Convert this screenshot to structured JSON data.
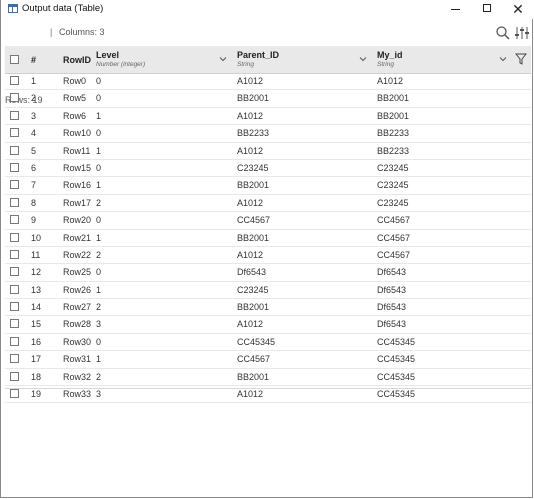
{
  "window": {
    "title": "Output data (Table)",
    "min_glyph": "",
    "max_glyph": "",
    "close_glyph": "✕"
  },
  "toolbar": {
    "rows_label": "Rows: 19",
    "separator": "|",
    "columns_label": "Columns: 3",
    "search_icon": "search-icon",
    "settings_icon": "sliders-icon"
  },
  "table": {
    "columns": {
      "index": {
        "name": "#"
      },
      "rowid": {
        "name": "RowID"
      },
      "level": {
        "name": "Level",
        "type": "Number (integer)"
      },
      "parent": {
        "name": "Parent_ID",
        "type": "String"
      },
      "myid": {
        "name": "My_id",
        "type": "String"
      }
    },
    "rows": [
      {
        "n": "1",
        "rowid": "Row0",
        "level": "0",
        "parent": "A1012",
        "myid": "A1012"
      },
      {
        "n": "2",
        "rowid": "Row5",
        "level": "0",
        "parent": "BB2001",
        "myid": "BB2001"
      },
      {
        "n": "3",
        "rowid": "Row6",
        "level": "1",
        "parent": "A1012",
        "myid": "BB2001"
      },
      {
        "n": "4",
        "rowid": "Row10",
        "level": "0",
        "parent": "BB2233",
        "myid": "BB2233"
      },
      {
        "n": "5",
        "rowid": "Row11",
        "level": "1",
        "parent": "A1012",
        "myid": "BB2233"
      },
      {
        "n": "6",
        "rowid": "Row15",
        "level": "0",
        "parent": "C23245",
        "myid": "C23245"
      },
      {
        "n": "7",
        "rowid": "Row16",
        "level": "1",
        "parent": "BB2001",
        "myid": "C23245"
      },
      {
        "n": "8",
        "rowid": "Row17",
        "level": "2",
        "parent": "A1012",
        "myid": "C23245"
      },
      {
        "n": "9",
        "rowid": "Row20",
        "level": "0",
        "parent": "CC4567",
        "myid": "CC4567"
      },
      {
        "n": "10",
        "rowid": "Row21",
        "level": "1",
        "parent": "BB2001",
        "myid": "CC4567"
      },
      {
        "n": "11",
        "rowid": "Row22",
        "level": "2",
        "parent": "A1012",
        "myid": "CC4567"
      },
      {
        "n": "12",
        "rowid": "Row25",
        "level": "0",
        "parent": "Df6543",
        "myid": "Df6543"
      },
      {
        "n": "13",
        "rowid": "Row26",
        "level": "1",
        "parent": "C23245",
        "myid": "Df6543"
      },
      {
        "n": "14",
        "rowid": "Row27",
        "level": "2",
        "parent": "BB2001",
        "myid": "Df6543"
      },
      {
        "n": "15",
        "rowid": "Row28",
        "level": "3",
        "parent": "A1012",
        "myid": "Df6543"
      },
      {
        "n": "16",
        "rowid": "Row30",
        "level": "0",
        "parent": "CC45345",
        "myid": "CC45345"
      },
      {
        "n": "17",
        "rowid": "Row31",
        "level": "1",
        "parent": "CC4567",
        "myid": "CC45345"
      },
      {
        "n": "18",
        "rowid": "Row32",
        "level": "2",
        "parent": "BB2001",
        "myid": "CC45345"
      },
      {
        "n": "19",
        "rowid": "Row33",
        "level": "3",
        "parent": "A1012",
        "myid": "CC45345"
      }
    ]
  },
  "colors": {
    "header_bg": "#e9e9e9",
    "row_border": "#e8e8e8"
  }
}
